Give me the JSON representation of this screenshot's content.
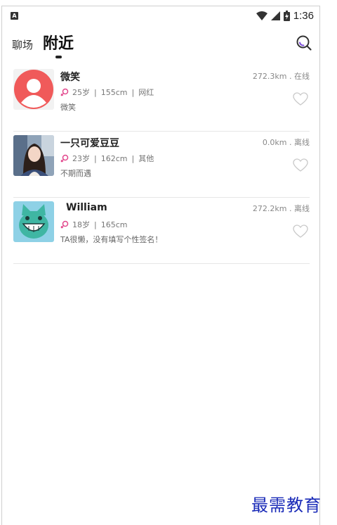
{
  "status_bar": {
    "time": "1:36",
    "left_icon": "A"
  },
  "header": {
    "tabs": [
      {
        "label": "聊场",
        "active": false
      },
      {
        "label": "附近",
        "active": true
      }
    ],
    "search_icon": "search-icon"
  },
  "users": [
    {
      "name": "微笑",
      "age": "25岁",
      "height": "155cm",
      "tag": "网红",
      "signature": "微笑",
      "distance": "272.3km . 在线",
      "avatar": "default-avatar"
    },
    {
      "name": "一只可爱豆豆",
      "age": "23岁",
      "height": "162cm",
      "tag": "其他",
      "signature": "不期而遇",
      "distance": "0.0km . 离线",
      "avatar": "photo-avatar"
    },
    {
      "name": "William",
      "age": "18岁",
      "height": "165cm",
      "tag": "",
      "signature": "TA很懒，没有填写个性签名！",
      "distance": "272.2km . 离线",
      "avatar": "cat-avatar"
    }
  ],
  "separator": "|",
  "watermark": "最需教育",
  "colors": {
    "gender_icon": "#e2478c",
    "avatar_default_bg": "#f05a5a",
    "watermark": "#1a2bb8"
  }
}
